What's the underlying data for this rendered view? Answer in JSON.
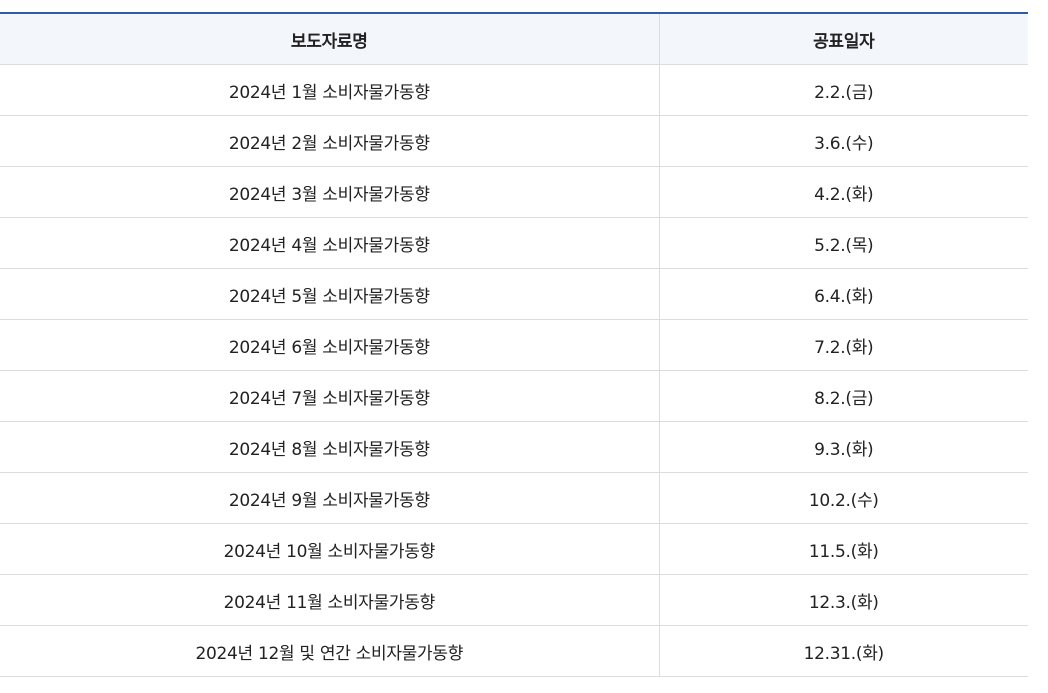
{
  "table": {
    "headers": [
      "보도자료명",
      "공표일자"
    ],
    "rows": [
      {
        "name": "2024년 1월 소비자물가동향",
        "date": "2.2.(금)"
      },
      {
        "name": "2024년 2월 소비자물가동향",
        "date": "3.6.(수)"
      },
      {
        "name": "2024년 3월 소비자물가동향",
        "date": "4.2.(화)"
      },
      {
        "name": "2024년 4월 소비자물가동향",
        "date": "5.2.(목)"
      },
      {
        "name": "2024년 5월 소비자물가동향",
        "date": "6.4.(화)"
      },
      {
        "name": "2024년 6월 소비자물가동향",
        "date": "7.2.(화)"
      },
      {
        "name": "2024년 7월 소비자물가동향",
        "date": "8.2.(금)"
      },
      {
        "name": "2024년 8월 소비자물가동향",
        "date": "9.3.(화)"
      },
      {
        "name": "2024년 9월 소비자물가동향",
        "date": "10.2.(수)"
      },
      {
        "name": "2024년 10월 소비자물가동향",
        "date": "11.5.(화)"
      },
      {
        "name": "2024년 11월 소비자물가동향",
        "date": "12.3.(화)"
      },
      {
        "name": "2024년 12월 및 연간 소비자물가동향",
        "date": "12.31.(화)"
      }
    ]
  },
  "colors": {
    "header_border": "#2f5ca8",
    "header_background": "#f3f6fb",
    "grid_line": "#dcdcdc"
  }
}
